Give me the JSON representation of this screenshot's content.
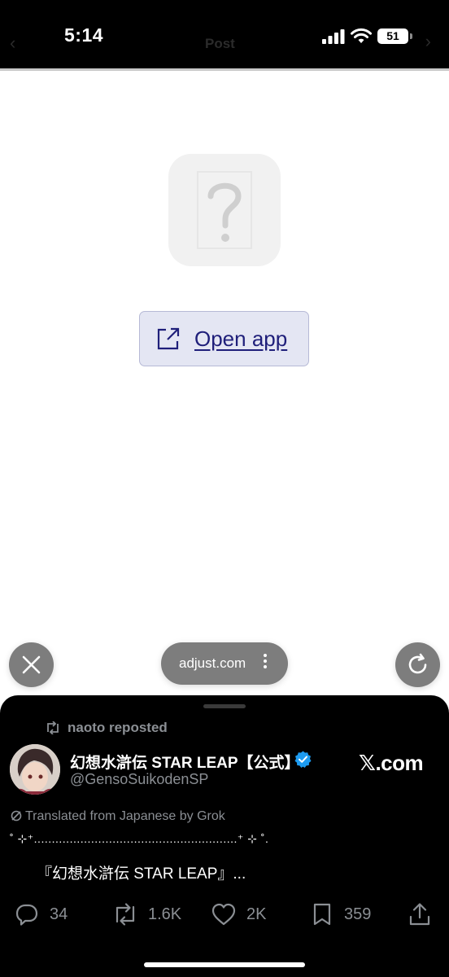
{
  "status_bar": {
    "time": "5:14",
    "battery": "51",
    "page_title_ghost": "Post"
  },
  "page": {
    "open_app_label": "Open app",
    "placeholder_icon": "question-mark-icon"
  },
  "browser_controls": {
    "url": "adjust.com",
    "more_icon": "⋮",
    "close_icon": "close-icon",
    "reload_icon": "reload-icon"
  },
  "tweet": {
    "reposted_by": "naoto reposted",
    "display_name": "幻想水滸伝 STAR LEAP【公式】",
    "handle": "@GensoSuikodenSP",
    "source": "𝕏.com",
    "translated_note": "Translated from Japanese by Grok",
    "decoration": "˚ ⊹⁺.........................................................⁺ ⊹ ˚.",
    "text": "『幻想水滸伝 STAR LEAP』...",
    "replies": "34",
    "reposts": "1.6K",
    "likes": "2K",
    "bookmarks": "359",
    "accent_color": "#1d9bf0"
  }
}
